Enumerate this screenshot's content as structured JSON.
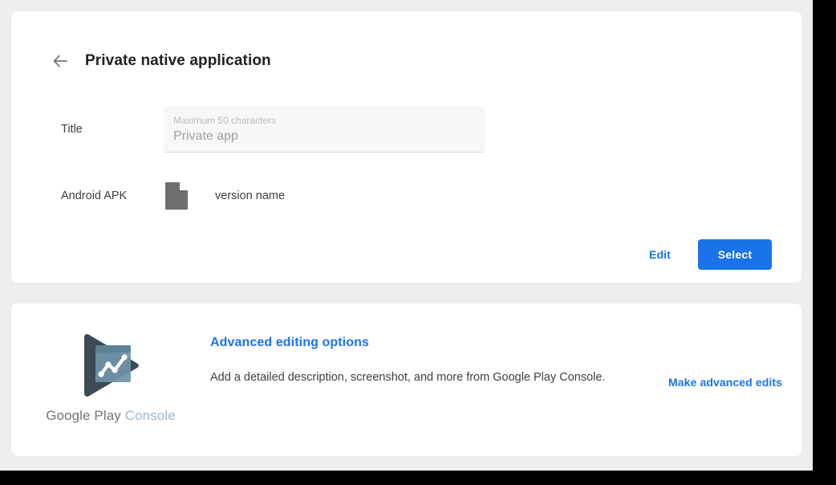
{
  "theme": {
    "accent": "#1a73e8",
    "page_background": "#eeeeee",
    "card_background": "#ffffff",
    "text_primary": "#3c4043",
    "text_title": "#202124",
    "field_background": "#f7f7f7",
    "placeholder": "#9aa0a6",
    "logo_dark": "#3c4a53",
    "logo_card": "#6f93a8",
    "wordmark_google": "#70757a",
    "wordmark_console": "#9fb4c7"
  },
  "header": {
    "back_icon": "arrow-left-icon",
    "title": "Private native application"
  },
  "form": {
    "title_row": {
      "label": "Title",
      "hint": "Maximum 50 characters",
      "value": "Private app",
      "placeholder": "Private app"
    },
    "apk_row": {
      "label": "Android APK",
      "file_icon": "document-file-icon",
      "version": "version name"
    }
  },
  "actions": {
    "edit_label": "Edit",
    "select_label": "Select"
  },
  "advanced": {
    "logo_icon": "google-play-console-logo-icon",
    "wordmark_google": "Google Play",
    "wordmark_console": "Console",
    "heading": "Advanced editing options",
    "description": "Add a detailed description, screenshot, and more from Google Play Console.",
    "link_label": "Make advanced edits"
  }
}
